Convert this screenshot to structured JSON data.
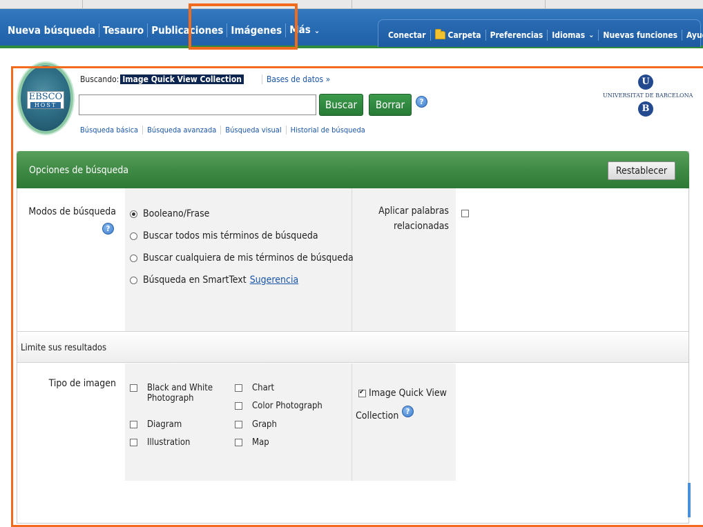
{
  "main_nav": {
    "items": [
      {
        "label": "Nueva búsqueda"
      },
      {
        "label": "Tesauro"
      },
      {
        "label": "Publicaciones"
      },
      {
        "label": "Imágenes"
      },
      {
        "label": "Más"
      }
    ],
    "more_chevron": "⌄"
  },
  "user_nav": {
    "items": [
      {
        "label": "Conectar"
      },
      {
        "label": "Carpeta",
        "icon": "folder-icon"
      },
      {
        "label": "Preferencias"
      },
      {
        "label": "Idiomas",
        "chevron": "⌄"
      },
      {
        "label": "Nuevas funciones"
      },
      {
        "label": "Ayuda"
      }
    ]
  },
  "logo": {
    "main": "EBSCO",
    "sub": "HOST"
  },
  "search": {
    "searching_label": "Buscando:",
    "database": "Image Quick View Collection",
    "databases_link": "Bases de datos »",
    "query": "",
    "search_button": "Buscar",
    "clear_button": "Borrar",
    "help": "?",
    "links": [
      "Búsqueda básica",
      "Búsqueda avanzada",
      "Búsqueda visual",
      "Historial de búsqueda"
    ]
  },
  "institution": {
    "letter_top": "U",
    "name": "UNIVERSITAT DE BARCELONA",
    "letter_bottom": "B"
  },
  "options": {
    "title": "Opciones de búsqueda",
    "reset_button": "Restablecer",
    "modes_label": "Modos de búsqueda",
    "modes": [
      {
        "label": "Booleano/Frase",
        "selected": true
      },
      {
        "label": "Buscar todos mis términos de búsqueda",
        "selected": false
      },
      {
        "label": "Buscar cualquiera de mis términos de búsqueda",
        "selected": false
      },
      {
        "label": "Búsqueda en SmartText",
        "selected": false,
        "link": "Sugerencia"
      }
    ],
    "related_label_line1": "Aplicar palabras",
    "related_label_line2": "relacionadas",
    "related_checked": false
  },
  "limits": {
    "title": "Limite sus resultados",
    "image_type_label": "Tipo de imagen",
    "image_types": [
      {
        "label": "Black and White Photograph",
        "checked": false
      },
      {
        "label": "Chart",
        "checked": false
      },
      {
        "label": "Color Photograph",
        "checked": false
      },
      {
        "label": "Diagram",
        "checked": false
      },
      {
        "label": "Graph",
        "checked": false
      },
      {
        "label": "Illustration",
        "checked": false
      },
      {
        "label": "Map",
        "checked": false
      }
    ],
    "collection_label_line1": "Image Quick View",
    "collection_label_line2": "Collection",
    "collection_checked": true
  },
  "colors": {
    "nav_blue": "#2a6fb7",
    "header_green": "#3f8a44",
    "button_green": "#277a36",
    "annotation_orange": "#f26a1b",
    "link_blue": "#1a55a8",
    "db_highlight": "#0c2450"
  }
}
